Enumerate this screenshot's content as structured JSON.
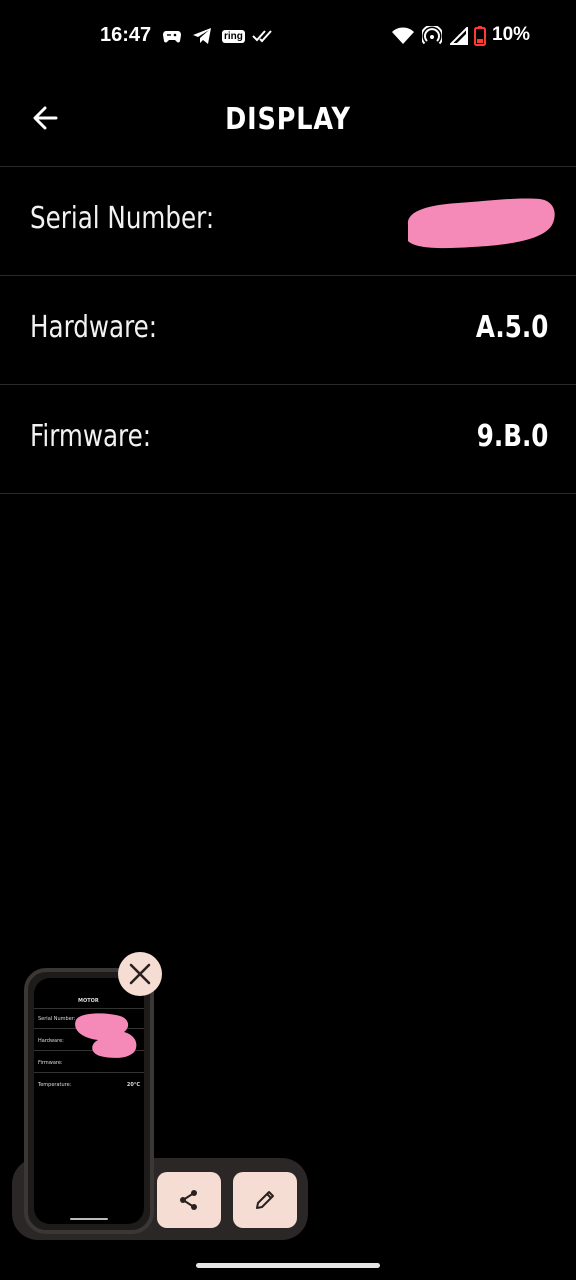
{
  "status_bar": {
    "time": "16:47",
    "ring_label": "ring",
    "battery_percent": "10%",
    "icons": [
      "game-controller-icon",
      "telegram-icon",
      "ring-icon",
      "double-check-icon",
      "wifi-icon",
      "hotspot-icon",
      "signal-icon",
      "battery-low-icon"
    ]
  },
  "header": {
    "title": "DISPLAY",
    "back_icon": "arrow-left-icon"
  },
  "rows": [
    {
      "label": "Serial Number:",
      "value": ""
    },
    {
      "label": "Hardware:",
      "value": "A.5.0"
    },
    {
      "label": "Firmware:",
      "value": "9.B.0"
    }
  ],
  "screenshot_preview": {
    "mini_title": "MOTOR",
    "mini_rows": [
      "Serial Number:",
      "Hardware:",
      "Firmware:",
      "Temperature:"
    ],
    "mini_value": "20°C",
    "actions": [
      "share-icon",
      "edit-icon"
    ],
    "close_icon": "close-icon"
  },
  "colors": {
    "background": "#000000",
    "accent_button": "#f6ddd4",
    "redaction": "#f58ab8"
  }
}
